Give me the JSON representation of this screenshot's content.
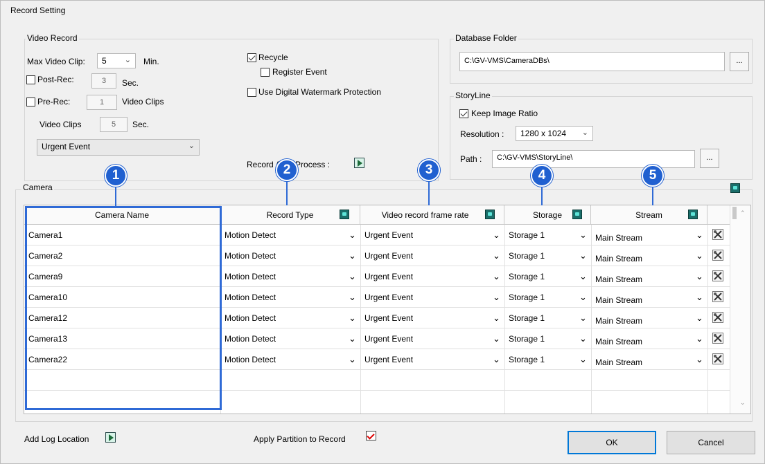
{
  "window_title": "Record Setting",
  "video_record": {
    "group_label": "Video Record",
    "max_clip_label": "Max Video Clip:",
    "max_clip_value": "5",
    "max_clip_unit": "Min.",
    "post_rec_label": "Post-Rec:",
    "post_rec_value": "3",
    "post_rec_unit": "Sec.",
    "pre_rec_label": "Pre-Rec:",
    "pre_rec_value": "1",
    "pre_rec_unit": "Video Clips",
    "video_clips_label": "Video Clips",
    "video_clips_value": "5",
    "video_clips_unit": "Sec.",
    "event_select": "Urgent Event",
    "recycle_label": "Recycle",
    "register_event_label": "Register Event",
    "watermark_label": "Use Digital Watermark Protection",
    "record_after_process_label": "Record After Process :"
  },
  "database": {
    "group_label": "Database Folder",
    "path": "C:\\GV-VMS\\CameraDBs\\",
    "browse": "..."
  },
  "storyline": {
    "group_label": "StoryLine",
    "keep_ratio_label": "Keep Image Ratio",
    "resolution_label": "Resolution :",
    "resolution_value": "1280 x 1024",
    "path_label": "Path :",
    "path_value": "C:\\GV-VMS\\StoryLine\\",
    "browse": "..."
  },
  "camera": {
    "group_label": "Camera",
    "columns": [
      "Camera Name",
      "Record Type",
      "Video record frame rate",
      "Storage",
      "Stream"
    ],
    "rows": [
      {
        "name": "Camera1",
        "record_type": "Motion Detect",
        "frame_rate": "Urgent Event",
        "storage": "Storage 1",
        "stream": "Main Stream"
      },
      {
        "name": "Camera2",
        "record_type": "Motion Detect",
        "frame_rate": "Urgent Event",
        "storage": "Storage 1",
        "stream": "Main Stream"
      },
      {
        "name": "Camera9",
        "record_type": "Motion Detect",
        "frame_rate": "Urgent Event",
        "storage": "Storage 1",
        "stream": "Main Stream"
      },
      {
        "name": "Camera10",
        "record_type": "Motion Detect",
        "frame_rate": "Urgent Event",
        "storage": "Storage 1",
        "stream": "Main Stream"
      },
      {
        "name": "Camera12",
        "record_type": "Motion Detect",
        "frame_rate": "Urgent Event",
        "storage": "Storage 1",
        "stream": "Main Stream"
      },
      {
        "name": "Camera13",
        "record_type": "Motion Detect",
        "frame_rate": "Urgent Event",
        "storage": "Storage 1",
        "stream": "Main Stream"
      },
      {
        "name": "Camera22",
        "record_type": "Motion Detect",
        "frame_rate": "Urgent Event",
        "storage": "Storage 1",
        "stream": "Main Stream"
      }
    ]
  },
  "badges": [
    "1",
    "2",
    "3",
    "4",
    "5"
  ],
  "footer": {
    "add_log_label": "Add Log Location",
    "apply_partition_label": "Apply Partition to Record",
    "ok": "OK",
    "cancel": "Cancel"
  },
  "colors": {
    "accent": "#2f6ad6",
    "badge": "#2060d0",
    "tool_icon": "#1b6e6a"
  }
}
